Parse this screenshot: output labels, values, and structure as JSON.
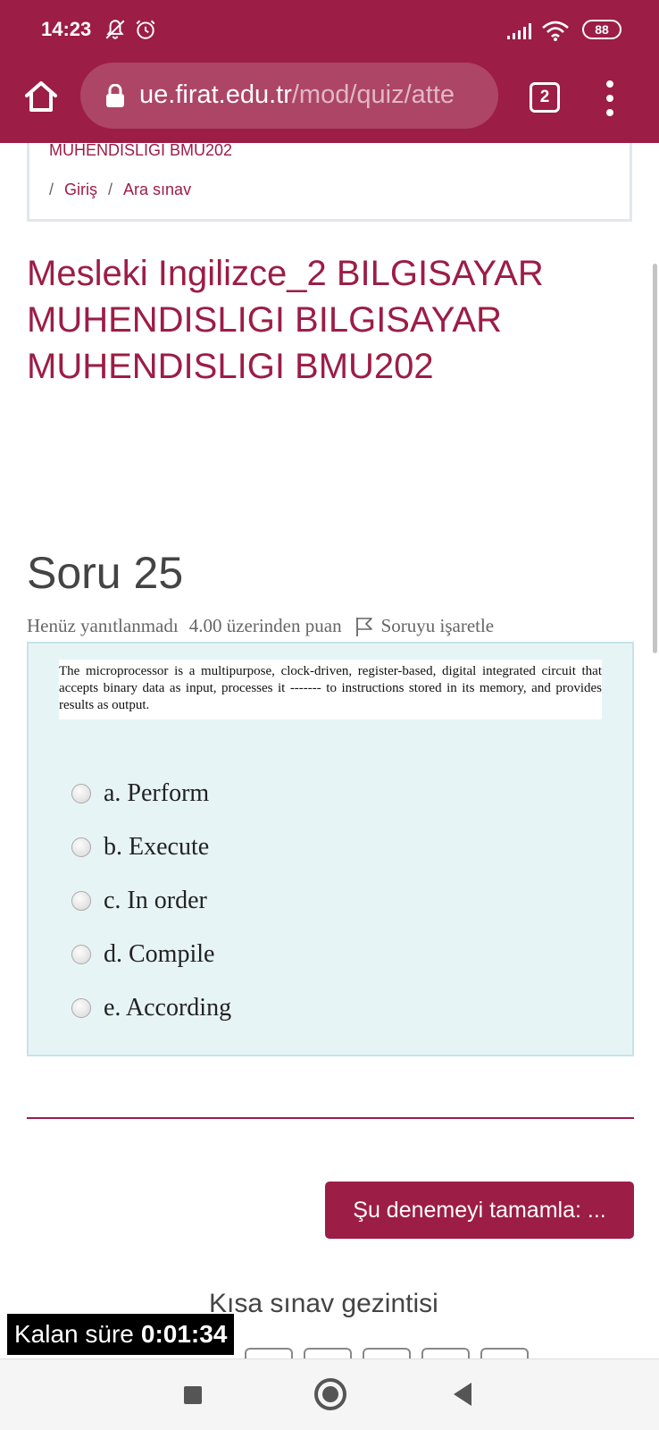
{
  "status_bar": {
    "time": "14:23",
    "battery": "88"
  },
  "browser": {
    "url_host": "ue.firat.edu.tr",
    "url_path": "/mod/quiz/atte",
    "tab_count": "2"
  },
  "breadcrumb": {
    "course_cut": "MUHENDISLIGI BMU202",
    "items": [
      "Giriş",
      "Ara sınav"
    ]
  },
  "page_title": "Mesleki Ingilizce_2 BILGISAYAR MUHENDISLIGI BILGISAYAR MUHENDISLIGI BMU202",
  "question": {
    "heading": "Soru 25",
    "state": "Henüz yanıtlanmadı",
    "grade": "4.00 üzerinden puan",
    "flag_label": "Soruyu işaretle",
    "text": "The microprocessor is a multipurpose, clock-driven, register-based, digital integrated circuit that accepts binary data as input, processes it ------- to instructions stored in its memory, and provides results as output.",
    "answers": [
      {
        "label": "a. Perform",
        "selected": false
      },
      {
        "label": "b. Execute",
        "selected": false
      },
      {
        "label": "c. In order",
        "selected": false
      },
      {
        "label": "d. Compile",
        "selected": false
      },
      {
        "label": "e. According",
        "selected": false
      }
    ]
  },
  "finish_button": "Şu denemeyi tamamla: ...",
  "quiz_nav_title": "Kısa sınav gezintisi",
  "timer": {
    "label": "Kalan süre",
    "value": "0:01:34"
  },
  "colors": {
    "brand": "#9c1d46",
    "question_bg": "#e7f4f6",
    "question_border": "#c6e3ea"
  }
}
